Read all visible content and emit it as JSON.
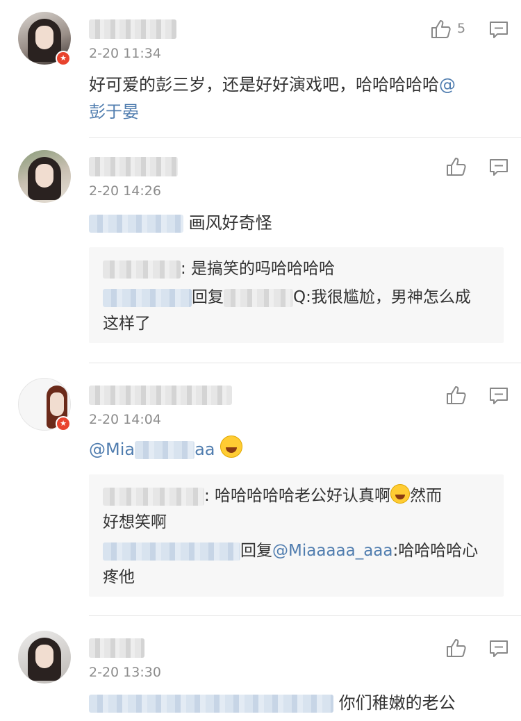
{
  "comments": [
    {
      "time": "2-20 11:34",
      "like_count": "5",
      "text_line1": "好可爱的彭三岁，还是好好演戏吧，哈哈哈哈哈",
      "mention_at": "@",
      "mention_name": "彭于晏"
    },
    {
      "time": "2-20 14:26",
      "body_text": "画风好奇怪",
      "replies": [
        {
          "text": ": 是搞笑的吗哈哈哈哈"
        },
        {
          "reply_word": "回复",
          "target_suffix": "Q",
          "text_line1": ":我很尴尬，男神怎么成",
          "text_line2": "这样了"
        }
      ]
    },
    {
      "time": "2-20 14:04",
      "mention_prefix": "@Mia",
      "mention_suffix": "aa",
      "replies": [
        {
          "text": ": 哈哈哈哈哈老公好认真啊",
          "text_after": "然而",
          "text_line2": "好想笑啊"
        },
        {
          "reply_word": "回复",
          "mention": "@Miaaaaa_aaa",
          "text_line1": ":哈哈哈哈心",
          "text_line2": "疼他"
        }
      ]
    },
    {
      "time": "2-20 13:30",
      "body_text": "你们稚嫩的老公"
    }
  ],
  "icons": {
    "like": "thumbs-up-icon",
    "reply": "comment-bubble-icon",
    "verified": "verified-badge-icon",
    "emoji": "laughing-tears-emoji"
  },
  "colors": {
    "mention": "#507daf",
    "timestamp": "#8c8c8c",
    "reply_background": "#f7f7f7",
    "badge": "#e8432e"
  }
}
